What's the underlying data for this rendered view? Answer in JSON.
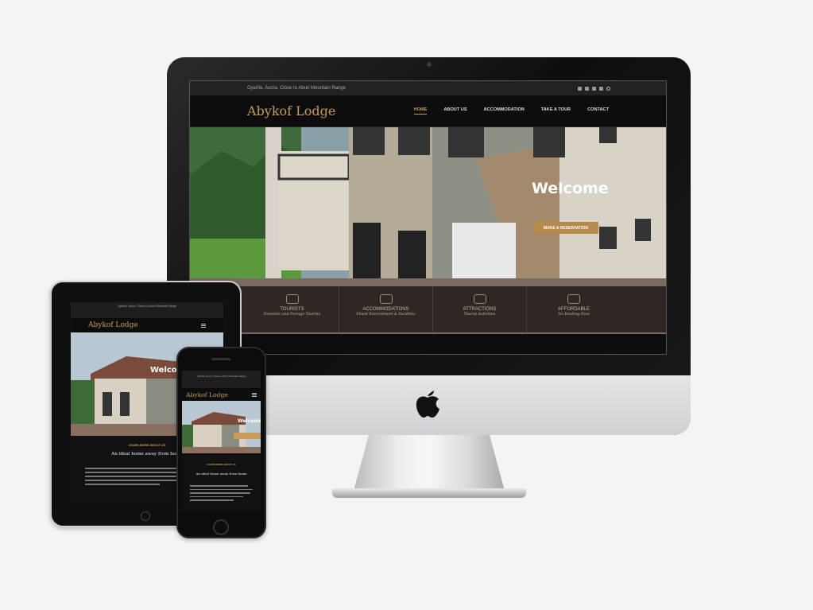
{
  "site": {
    "brand": "Abykof Lodge",
    "location": "Oyarifa, Accra. Close to Aburi Mountain Range",
    "location_short": "Oyarifa, Accra. Close to Aburi Mountain Range",
    "nav": [
      "HOME",
      "ABOUT US",
      "ACCOMMODATION",
      "TAKE A TOUR",
      "CONTACT"
    ],
    "hero_title": "Welcome",
    "cta_label": "MAKE A RESERVATION",
    "features": [
      {
        "title": "TOURISTS",
        "subtitle": "Domestic and Foreign Tourists",
        "icon": "shoe-icon"
      },
      {
        "title": "ACCOMMODATIONS",
        "subtitle": "Finest Environment & Facilities",
        "icon": "bed-icon"
      },
      {
        "title": "ATTRACTIONS",
        "subtitle": "Tourist Activities",
        "icon": "mountain-icon"
      },
      {
        "title": "AFFORDABLE",
        "subtitle": "No Booking Fees",
        "icon": "tag-icon"
      }
    ],
    "about_kicker": "LEARN MORE ABOUT US",
    "about_heading": "An ideal home away from home"
  },
  "colors": {
    "accent": "#c89b5a",
    "dark": "#111111"
  }
}
